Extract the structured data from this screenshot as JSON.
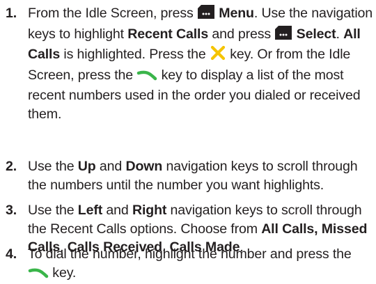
{
  "steps": [
    {
      "number": "1.",
      "segments": [
        {
          "t": "From the Idle Screen, press "
        },
        {
          "icon": "menu-softkey-icon"
        },
        {
          "t": " "
        },
        {
          "b": "Menu"
        },
        {
          "t": ". Use the navigation keys to highlight "
        },
        {
          "b": "Recent Calls"
        },
        {
          "t": " and press "
        },
        {
          "icon": "menu-softkey-icon"
        },
        {
          "t": " "
        },
        {
          "b": "Select"
        },
        {
          "t": ". "
        },
        {
          "b": "All Calls"
        },
        {
          "t": " is highlighted. Press the "
        },
        {
          "icon": "recent-calls-key-icon"
        },
        {
          "t": " key. Or from the Idle Screen, press the "
        },
        {
          "icon": "send-key-icon"
        },
        {
          "t": " key to display a list of the most recent numbers used in the order you dialed or received them."
        }
      ]
    },
    {
      "number": "2.",
      "segments": [
        {
          "t": "Use the "
        },
        {
          "b": "Up"
        },
        {
          "t": " and "
        },
        {
          "b": "Down"
        },
        {
          "t": " navigation keys to scroll through the numbers until the number you want highlights."
        }
      ]
    },
    {
      "number": "3.",
      "segments": [
        {
          "t": "Use the "
        },
        {
          "b": "Left"
        },
        {
          "t": " and "
        },
        {
          "b": "Right"
        },
        {
          "t": " navigation keys to scroll through the Recent Calls options. Choose from "
        },
        {
          "b": "All Calls, Missed Calls"
        },
        {
          "t": ", "
        },
        {
          "b": "Calls Received"
        },
        {
          "t": ", "
        },
        {
          "b": "Calls Made"
        },
        {
          "t": "."
        }
      ]
    },
    {
      "number": "4.",
      "segments": [
        {
          "t": "To dial the number, highlight the number and press the "
        },
        {
          "icon": "send-key-icon"
        },
        {
          "t": " key."
        }
      ]
    }
  ],
  "colors": {
    "text": "#231f20",
    "menu_key": "#231f20",
    "recent_calls_key": "#f5c400",
    "send_key": "#3ab54a"
  }
}
